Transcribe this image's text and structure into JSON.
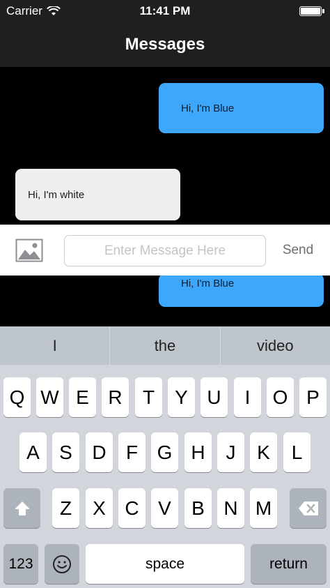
{
  "status_bar": {
    "carrier": "Carrier",
    "time": "11:41 PM"
  },
  "nav": {
    "title": "Messages"
  },
  "messages": [
    {
      "text": "Hi, I'm Blue",
      "style": "blue"
    },
    {
      "text": "Hi, I'm white",
      "style": "white"
    },
    {
      "text": "Hi, I'm Blue",
      "style": "blue"
    }
  ],
  "composer": {
    "image_icon": "photo-icon",
    "placeholder": "Enter Message Here",
    "send_label": "Send"
  },
  "keyboard": {
    "suggestions": [
      "I",
      "the",
      "video"
    ],
    "row1": [
      "Q",
      "W",
      "E",
      "R",
      "T",
      "Y",
      "U",
      "I",
      "O",
      "P"
    ],
    "row2": [
      "A",
      "S",
      "D",
      "F",
      "G",
      "H",
      "J",
      "K",
      "L"
    ],
    "row3": [
      "Z",
      "X",
      "C",
      "V",
      "B",
      "N",
      "M"
    ],
    "shift_icon": "shift-icon",
    "delete_icon": "delete-icon",
    "numbers_label": "123",
    "emoji_icon": "emoji-icon",
    "space_label": "space",
    "return_label": "return"
  },
  "colors": {
    "bar_bg": "#1f1f1f",
    "blue_bubble": "#3da7fb",
    "white_bubble": "#efefef",
    "keyboard_bg": "#d2d6dc"
  }
}
